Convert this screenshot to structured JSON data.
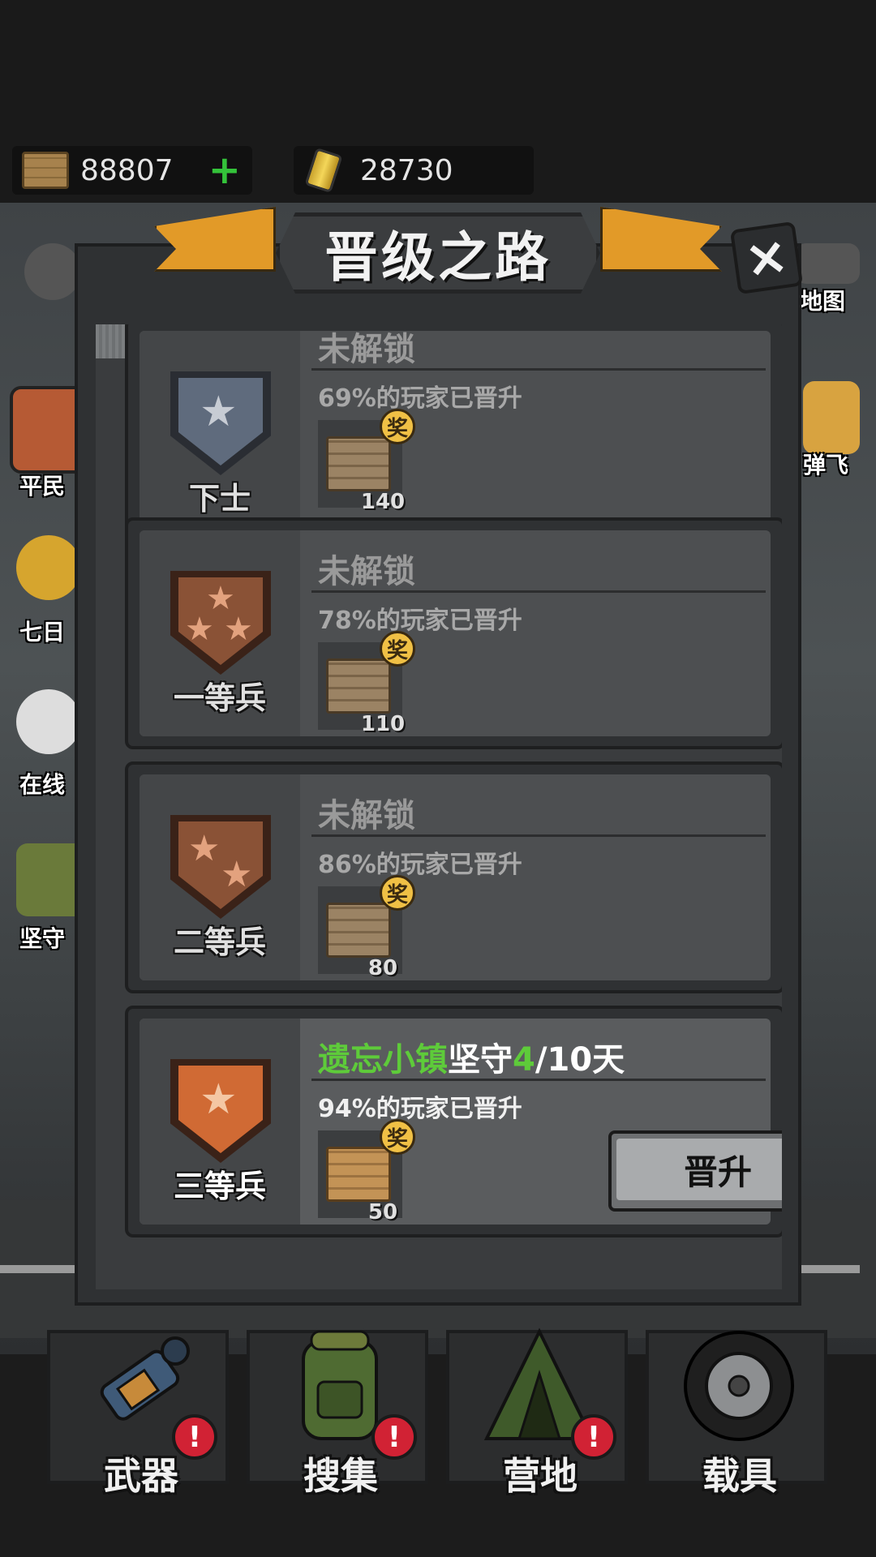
{
  "resources": {
    "crates": "88807",
    "cans": "28730"
  },
  "side_menu": {
    "left": [
      "平民",
      "七日",
      "在线",
      "坚守"
    ],
    "right": [
      "地图",
      "弹飞"
    ]
  },
  "dialog": {
    "title": "晋级之路",
    "close_label": "×"
  },
  "ranks": [
    {
      "name": "下士",
      "status": "未解锁",
      "percent_text": "69%的玩家已晋升",
      "reward_badge": "奖",
      "reward_amount": "140",
      "stars": 1,
      "color": "#5f6b7d"
    },
    {
      "name": "一等兵",
      "status": "未解锁",
      "percent_text": "78%的玩家已晋升",
      "reward_badge": "奖",
      "reward_amount": "110",
      "stars": 3,
      "color": "#8a5236"
    },
    {
      "name": "二等兵",
      "status": "未解锁",
      "percent_text": "86%的玩家已晋升",
      "reward_badge": "奖",
      "reward_amount": "80",
      "stars": 2,
      "color": "#8a5236"
    },
    {
      "name": "三等兵",
      "status_prefix": "遗忘小镇",
      "status_mid": "坚守",
      "status_progress": "4",
      "status_suffix": "/10天",
      "percent_text": "94%的玩家已晋升",
      "reward_badge": "奖",
      "reward_amount": "50",
      "stars": 1,
      "color": "#c9632f",
      "promote_label": "晋升"
    }
  ],
  "nav": [
    {
      "label": "武器",
      "alert": "!"
    },
    {
      "label": "搜集",
      "alert": "!"
    },
    {
      "label": "营地",
      "alert": "!"
    },
    {
      "label": "载具"
    }
  ],
  "colors": {
    "accent_green": "#5ecb3a",
    "ribbon": "#e29a28",
    "alert_red": "#d12234"
  }
}
